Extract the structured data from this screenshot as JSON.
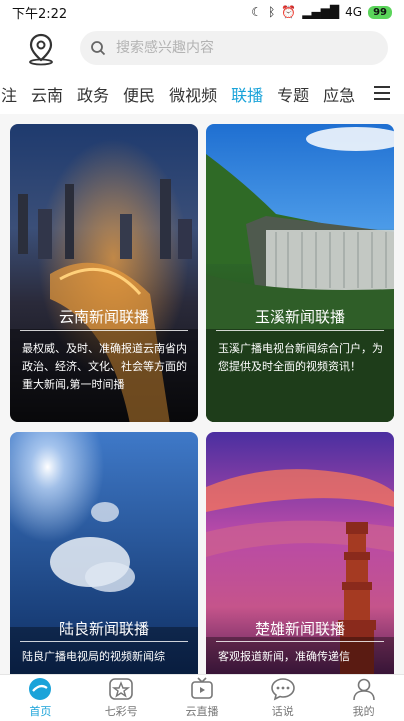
{
  "status": {
    "time": "下午2:22",
    "network": "4G",
    "battery": "99"
  },
  "header": {
    "search_placeholder": "搜索感兴趣内容"
  },
  "tabs": [
    {
      "label": "注"
    },
    {
      "label": "云南"
    },
    {
      "label": "政务"
    },
    {
      "label": "便民"
    },
    {
      "label": "微视频"
    },
    {
      "label": "联播",
      "active": true
    },
    {
      "label": "专题"
    },
    {
      "label": "应急"
    }
  ],
  "cards": [
    {
      "title": "云南新闻联播",
      "desc": "最权威、及时、准确报道云南省内政治、经济、文化、社会等方面的重大新闻,第一时间播"
    },
    {
      "title": "玉溪新闻联播",
      "desc": "玉溪广播电视台新闻综合门户，为您提供及时全面的视频资讯！"
    },
    {
      "title": "陆良新闻联播",
      "desc": "陆良广播电视局的视频新闻综"
    },
    {
      "title": "楚雄新闻联播",
      "desc": "客观报道新闻，准确传递信"
    }
  ],
  "bottom_nav": [
    {
      "label": "首页",
      "icon": "home-icon",
      "active": true
    },
    {
      "label": "七彩号",
      "icon": "star-icon"
    },
    {
      "label": "云直播",
      "icon": "tv-icon"
    },
    {
      "label": "话说",
      "icon": "chat-icon"
    },
    {
      "label": "我的",
      "icon": "user-icon"
    }
  ],
  "colors": {
    "accent": "#1aa3d9"
  }
}
